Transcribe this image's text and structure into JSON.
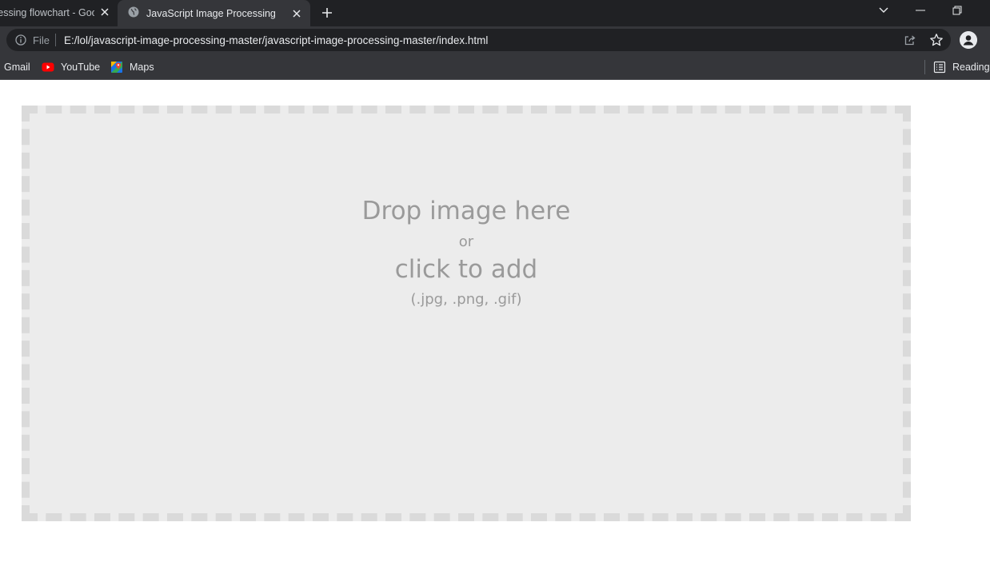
{
  "browser": {
    "tabs": [
      {
        "title": "cessing flowchart - Goo",
        "active": false
      },
      {
        "title": "JavaScript Image Processing",
        "active": true
      }
    ],
    "address": {
      "scheme_label": "File",
      "url": "E:/lol/javascript-image-processing-master/javascript-image-processing-master/index.html"
    },
    "bookmarks": [
      {
        "label": "Gmail",
        "icon": "gmail-icon"
      },
      {
        "label": "YouTube",
        "icon": "youtube-icon"
      },
      {
        "label": "Maps",
        "icon": "maps-icon"
      }
    ],
    "reading_list_label": "Reading list"
  },
  "dropzone": {
    "line1": "Drop image here",
    "line2": "or",
    "line3": "click to add",
    "line4": "(.jpg, .png, .gif)"
  },
  "colors": {
    "tabstrip_bg": "#202124",
    "toolbar_bg": "#35363a",
    "dropzone_bg": "#ececec",
    "dropzone_border": "#dadada",
    "dropzone_text": "#9a9a9a"
  }
}
